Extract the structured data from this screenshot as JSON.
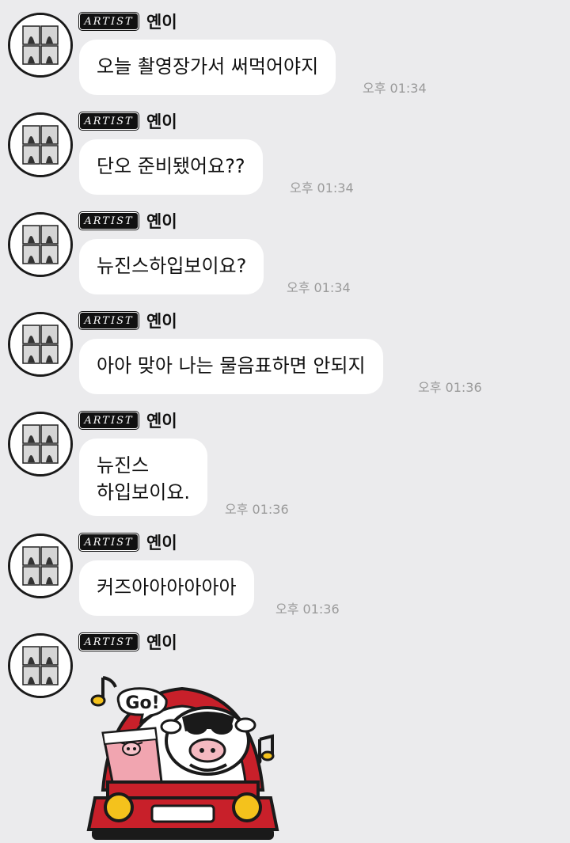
{
  "sender": {
    "badge": "ARTIST",
    "name": "옌이"
  },
  "messages": [
    {
      "text": "오늘 촬영장가서 써먹어야지",
      "time": "오후 01:34"
    },
    {
      "text": "단오 준비됐어요??",
      "time": "오후 01:34"
    },
    {
      "text": "뉴진스하입보이요?",
      "time": "오후 01:34"
    },
    {
      "text": "아아 맞아 나는 물음표하면 안되지",
      "time": "오후 01:36"
    },
    {
      "text": "뉴진스\n하입보이요.",
      "time": "오후 01:36"
    },
    {
      "text": "커즈아아아아아아",
      "time": "오후 01:36"
    }
  ],
  "sticker": {
    "text": "Go!",
    "description": "cow-driving-car-sticker"
  },
  "colors": {
    "background": "#ebebed",
    "bubble": "#ffffff",
    "time": "#9a9a9a",
    "badge": "#111111",
    "car": "#c8202a"
  }
}
